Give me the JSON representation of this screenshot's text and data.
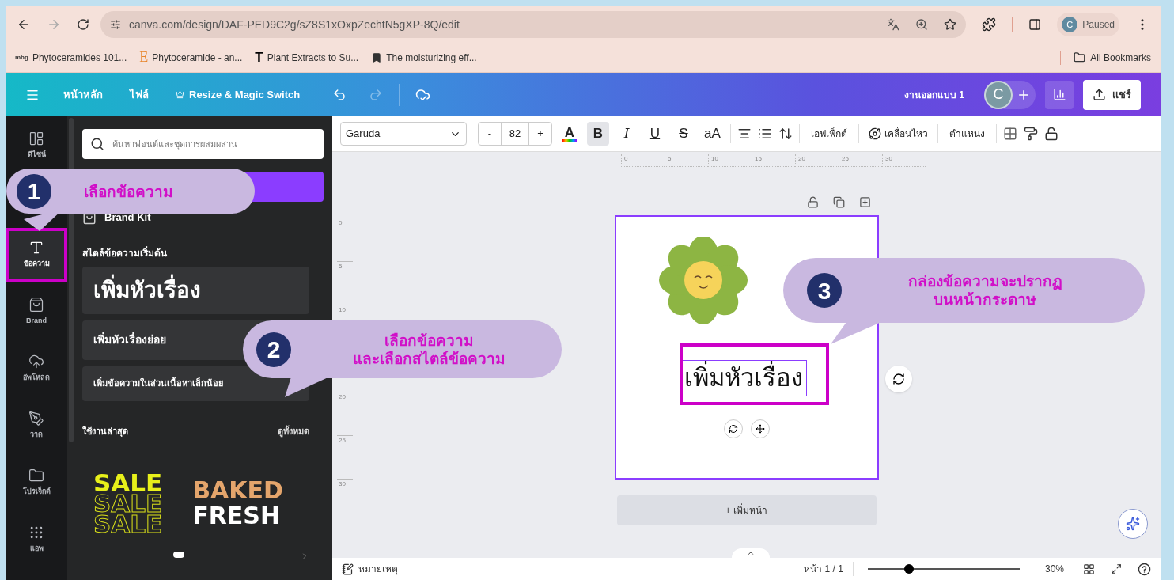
{
  "browser": {
    "url": "canva.com/design/DAF-PED9C2g/sZ8S1xOxpZechtN5gXP-8Q/edit",
    "profile_initial": "C",
    "profile_label": "Paused",
    "bookmarks": [
      {
        "kind": "text",
        "favicon": "mbg",
        "label": "Phytoceramides 101..."
      },
      {
        "kind": "text",
        "favicon": "E",
        "label": "Phytoceramide - an..."
      },
      {
        "kind": "text",
        "favicon": "T",
        "label": "Plant Extracts to Su..."
      },
      {
        "kind": "icon",
        "label": "The moisturizing eff..."
      }
    ],
    "all_bookmarks": "All Bookmarks"
  },
  "header": {
    "menu": [
      "หน้าหลัก",
      "ไฟล์"
    ],
    "resize": "Resize & Magic Switch",
    "title": "งานออกแบบ 1",
    "avatar": "C",
    "share": "แชร์"
  },
  "rail": [
    {
      "kind": "layout",
      "label": "ดีไซน์",
      "selected": false
    },
    {
      "kind": "text",
      "label": "ข้อความ",
      "selected": true
    },
    {
      "kind": "brand",
      "label": "Brand",
      "selected": false
    },
    {
      "kind": "upload",
      "label": "อัพโหลด",
      "selected": false
    },
    {
      "kind": "draw",
      "label": "วาด",
      "selected": false
    },
    {
      "kind": "folder",
      "label": "โปรเจ็กต์",
      "selected": false
    },
    {
      "kind": "apps",
      "label": "แอพ",
      "selected": false
    }
  ],
  "panel": {
    "search_placeholder": "ค้นหาฟอนต์และชุดการผสมผสาน",
    "brand_kit": "Brand Kit",
    "section_title": "สไตล์ข้อความเริ่มต้น",
    "styles": [
      {
        "kind": "heading",
        "label": "เพิ่มหัวเรื่อง"
      },
      {
        "kind": "subheading",
        "label": "เพิ่มหัวเรื่องย่อย"
      },
      {
        "kind": "body",
        "label": "เพิ่มข้อความในส่วนเนื้อหาเล็กน้อย"
      }
    ],
    "recent_title": "ใช้งานล่าสุด",
    "see_all": "ดูทั้งหมด",
    "recent": [
      {
        "kind": "sale",
        "lines": [
          "SALE",
          "SALE",
          "SALE"
        ]
      },
      {
        "kind": "baked",
        "lines": [
          "BAKED",
          "FRESH"
        ]
      }
    ]
  },
  "toolbar": {
    "font": "Garuda",
    "minus": "-",
    "size": "82",
    "plus": "+",
    "tools": [
      {
        "kind": "color",
        "label": "A",
        "selected": false
      },
      {
        "kind": "bold",
        "label": "B",
        "selected": true
      },
      {
        "kind": "italic",
        "label": "I",
        "selected": false
      },
      {
        "kind": "underline",
        "label": "U",
        "selected": false
      },
      {
        "kind": "strike",
        "label": "S",
        "selected": false
      },
      {
        "kind": "case",
        "label": "aA",
        "selected": false
      }
    ],
    "effects": "เอฟเฟ็กต์",
    "animate": "เคลื่อนไหว",
    "position": "ตำแหน่ง"
  },
  "ruler": {
    "horizontal": [
      "0",
      "5",
      "10",
      "15",
      "20",
      "25",
      "30"
    ],
    "vertical": [
      "0",
      "5",
      "10",
      "20",
      "25",
      "30"
    ]
  },
  "page": {
    "heading": "เพิ่มหัวเรื่อง"
  },
  "add_page": "+ เพิ่มหน้า",
  "footer": {
    "notes": "หมายเหตุ",
    "page": "หน้า 1 / 1",
    "level": 0.27,
    "zoom": "30%"
  },
  "callouts": [
    {
      "number": "1",
      "lines": [
        "เลือกข้อความ"
      ]
    },
    {
      "number": "2",
      "lines": [
        "เลือกข้อความ",
        "และเลือกสไตล์ข้อความ"
      ]
    },
    {
      "number": "3",
      "lines": [
        "กล่องข้อความจะปรากฏ",
        "บนหน้ากระดาษ"
      ]
    }
  ]
}
